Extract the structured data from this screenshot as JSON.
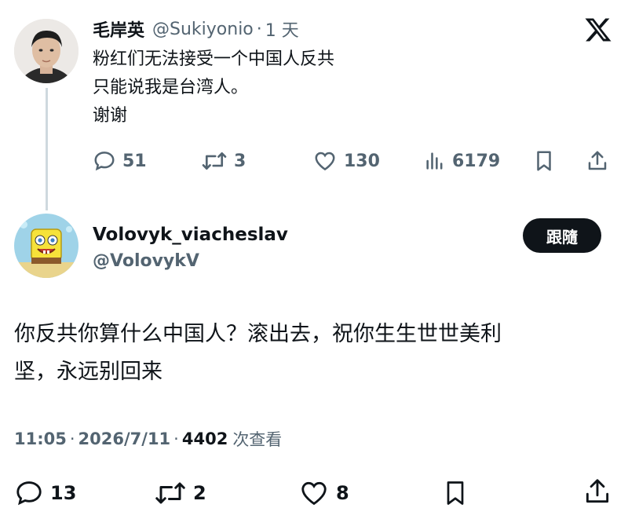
{
  "parent_tweet": {
    "display_name": "毛岸英",
    "handle": "@Sukiyonio",
    "separator": "·",
    "time": "1 天",
    "lines": [
      "粉红们无法接受一个中国人反共",
      "只能说我是台湾人。",
      "谢谢"
    ],
    "stats": {
      "replies": "51",
      "retweets": "3",
      "likes": "130",
      "views": "6179"
    }
  },
  "reply_tweet": {
    "display_name": "Volovyk_viacheslav",
    "handle": "@VolovykV",
    "follow_label": "跟隨",
    "lines": [
      "你反共你算什么中国人？滚出去，祝你生生世世美利",
      "坚，永远别回来"
    ],
    "meta": {
      "time": "11:05",
      "sep1": "·",
      "date": "2026/7/11",
      "sep2": "·",
      "views": "4402",
      "views_label": "次查看"
    },
    "stats": {
      "replies": "13",
      "retweets": "2",
      "likes": "8"
    }
  },
  "brand": {
    "logo": "x-logo-icon"
  },
  "colors": {
    "text": "#0f1419",
    "muted": "#536471",
    "thread_line": "#cfd9de",
    "button_bg": "#0f1419"
  }
}
